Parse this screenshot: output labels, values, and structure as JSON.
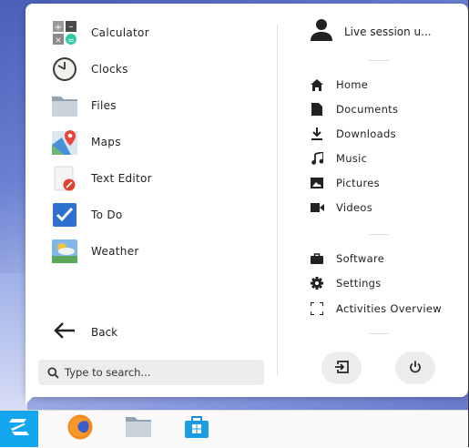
{
  "apps": [
    {
      "label": "Calculator",
      "icon": "calculator-icon"
    },
    {
      "label": "Clocks",
      "icon": "clocks-icon"
    },
    {
      "label": "Files",
      "icon": "files-icon"
    },
    {
      "label": "Maps",
      "icon": "maps-icon"
    },
    {
      "label": "Text Editor",
      "icon": "text-editor-icon"
    },
    {
      "label": "To Do",
      "icon": "todo-icon"
    },
    {
      "label": "Weather",
      "icon": "weather-icon"
    }
  ],
  "back_label": "Back",
  "search": {
    "placeholder": "Type to search..."
  },
  "user": {
    "label": "Live session u..."
  },
  "places": [
    {
      "label": "Home",
      "icon": "home-icon"
    },
    {
      "label": "Documents",
      "icon": "document-icon"
    },
    {
      "label": "Downloads",
      "icon": "download-icon"
    },
    {
      "label": "Music",
      "icon": "music-icon"
    },
    {
      "label": "Pictures",
      "icon": "picture-icon"
    },
    {
      "label": "Videos",
      "icon": "video-icon"
    }
  ],
  "system": [
    {
      "label": "Software",
      "icon": "software-icon"
    },
    {
      "label": "Settings",
      "icon": "gear-icon"
    },
    {
      "label": "Activities Overview",
      "icon": "activities-icon"
    }
  ],
  "taskbar": [
    "zorin-menu-icon",
    "firefox-icon",
    "files-icon",
    "software-store-icon"
  ],
  "colors": {
    "accent": "#15a6f0",
    "text": "#222222",
    "panel": "#ffffff",
    "search_bg": "#ececec"
  }
}
